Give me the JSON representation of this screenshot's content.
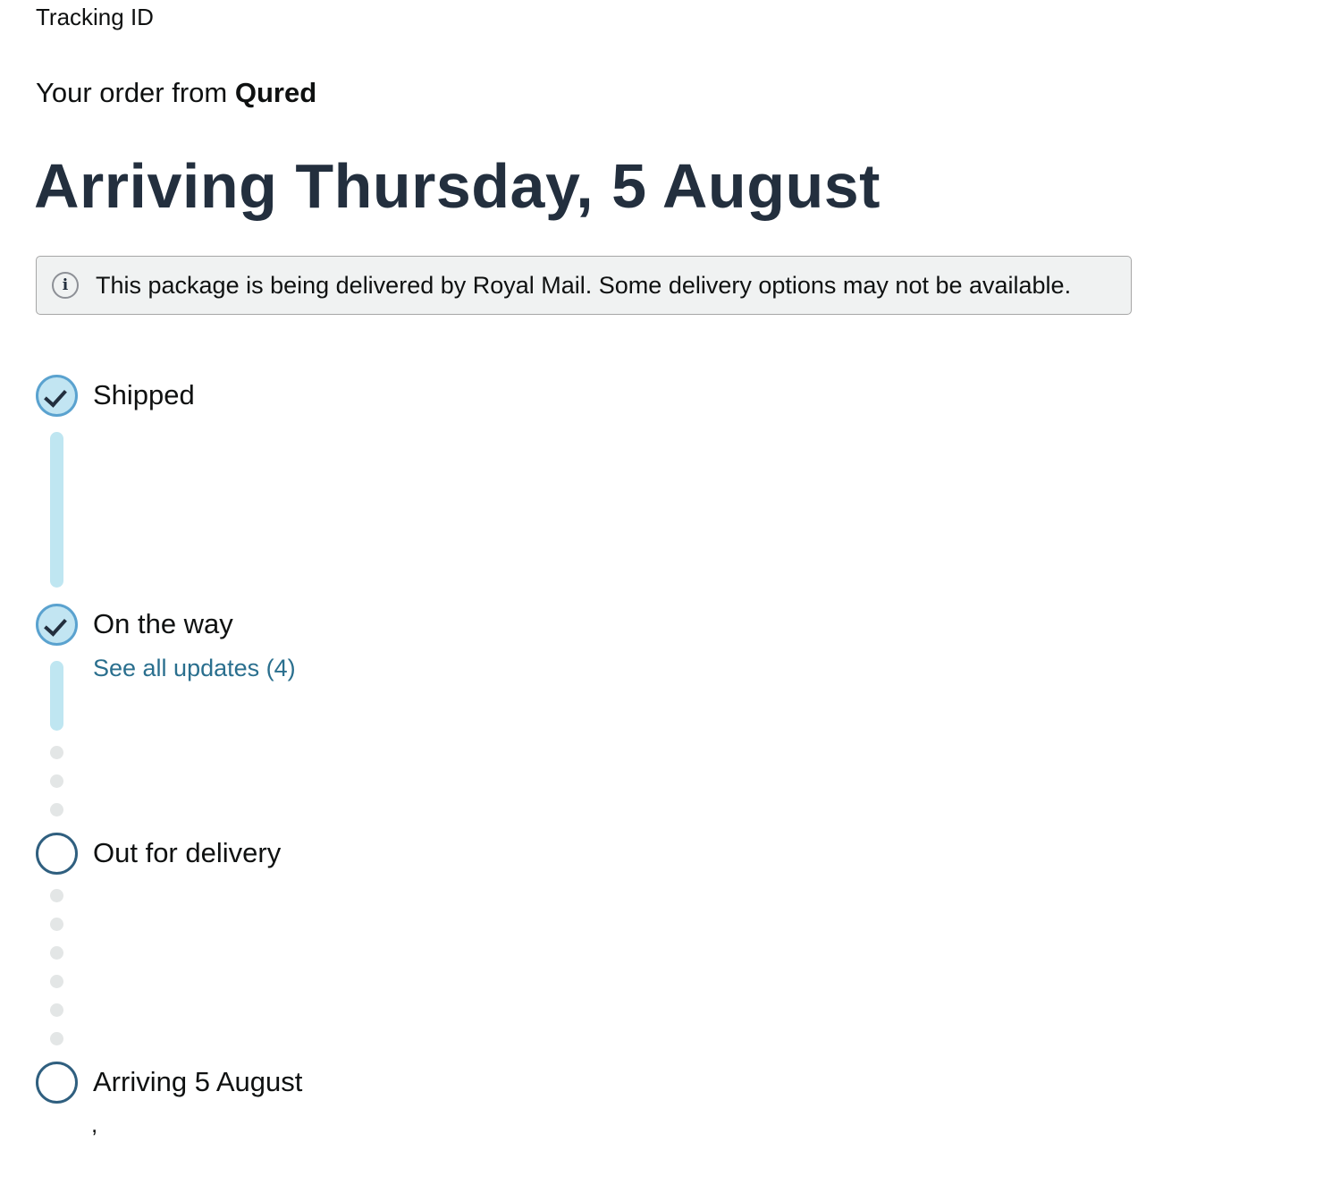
{
  "header": {
    "tracking_id_label": "Tracking ID",
    "order_from_prefix": "Your order from ",
    "seller_name": "Qured",
    "arrival_heading": "Arriving Thursday, 5 August"
  },
  "notice": {
    "icon": "info-icon",
    "icon_glyph": "i",
    "text": "This package is being delivered by Royal Mail. Some delivery options may not be available."
  },
  "timeline": {
    "steps": [
      {
        "label": "Shipped",
        "status": "done"
      },
      {
        "label": "On the way",
        "status": "done",
        "link": "See all updates (4)"
      },
      {
        "label": "Out for delivery",
        "status": "pending"
      },
      {
        "label": "Arriving 5 August",
        "status": "pending",
        "subtext": ","
      }
    ]
  },
  "colors": {
    "heading": "#232f3e",
    "link": "#2a6f8e",
    "progress_fill": "#bfe6f1",
    "progress_border": "#5aa2cf",
    "pending_border": "#2f5f7f",
    "dot": "#e3e6e6",
    "notice_bg": "#f0f2f2"
  }
}
